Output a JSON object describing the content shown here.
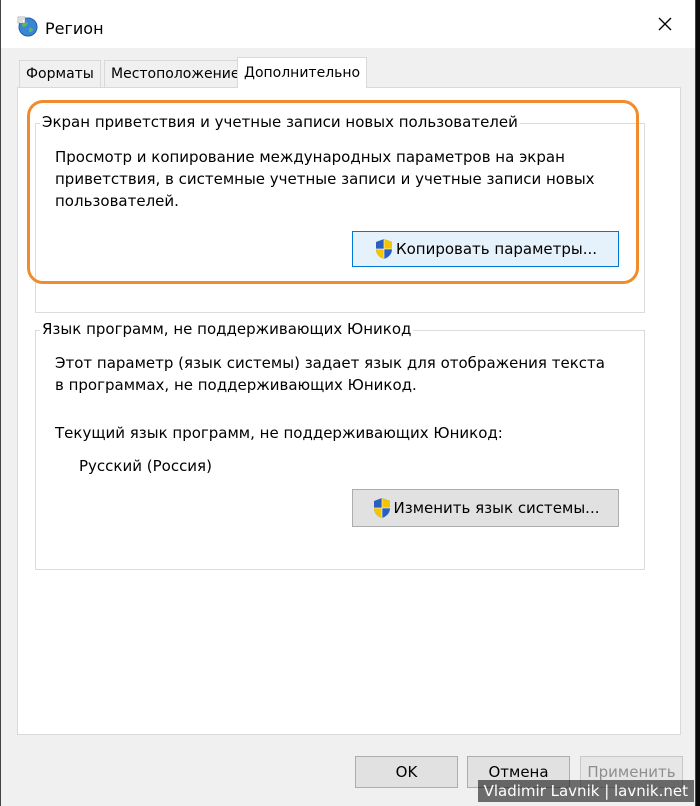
{
  "window": {
    "title": "Регион",
    "icon": "globe-region-icon",
    "close_icon": "close-icon"
  },
  "tabs": [
    {
      "label": "Форматы",
      "active": false
    },
    {
      "label": "Местоположение",
      "active": false
    },
    {
      "label": "Дополнительно",
      "active": true
    }
  ],
  "welcome_group": {
    "legend": "Экран приветствия и учетные записи новых пользователей",
    "description": "Просмотр и копирование международных параметров на экран приветствия, в системные учетные записи и учетные записи новых пользователей.",
    "button_label": "Копировать параметры...",
    "button_icon": "uac-shield-icon"
  },
  "unicode_group": {
    "legend": "Язык программ, не поддерживающих Юникод",
    "description": "Этот параметр (язык системы) задает язык для отображения текста в программах, не поддерживающих Юникод.",
    "current_label": "Текущий язык программ, не поддерживающих Юникод:",
    "current_value": "Русский (Россия)",
    "button_label": "Изменить язык системы...",
    "button_icon": "uac-shield-icon"
  },
  "footer": {
    "ok": "OK",
    "cancel": "Отмена",
    "apply": "Применить"
  },
  "watermark": "Vladimir Lavnik | lavnik.net",
  "colors": {
    "highlight": "#f08c2e",
    "button_hover": "#e5f1fb",
    "button_hover_border": "#0078d7"
  }
}
